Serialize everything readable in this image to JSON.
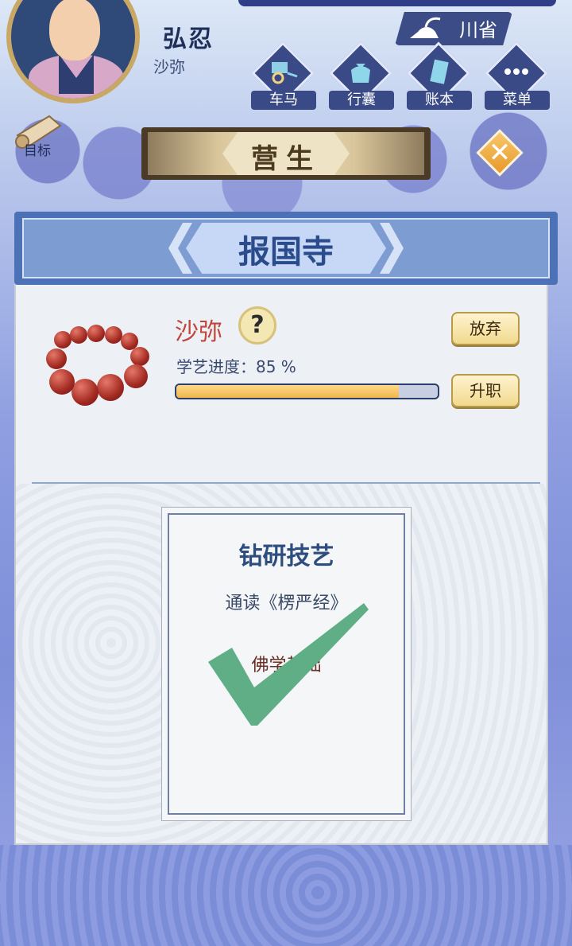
{
  "player": {
    "name": "弘忍",
    "rank": "沙弥"
  },
  "location": {
    "label": "川省"
  },
  "nav": [
    {
      "label": "车马",
      "icon": "cart-icon"
    },
    {
      "label": "行囊",
      "icon": "bundle-icon"
    },
    {
      "label": "账本",
      "icon": "ledger-icon"
    },
    {
      "label": "菜单",
      "icon": "more-icon"
    }
  ],
  "goal": {
    "label": "目标"
  },
  "screen": {
    "title": "营生"
  },
  "temple": {
    "name": "报国寺"
  },
  "job": {
    "title": "沙弥",
    "help_symbol": "?",
    "progress_label": "学艺进度：85 %",
    "progress_percent": 85,
    "abandon_label": "放弃",
    "promote_label": "升职"
  },
  "task_card": {
    "title": "钻研技艺",
    "subtitle": "通读《楞严经》",
    "note": "佛学基础",
    "completed": true
  },
  "colors": {
    "check": "#5fae86",
    "accent": "#4d71b6",
    "title_red": "#c0463c"
  }
}
